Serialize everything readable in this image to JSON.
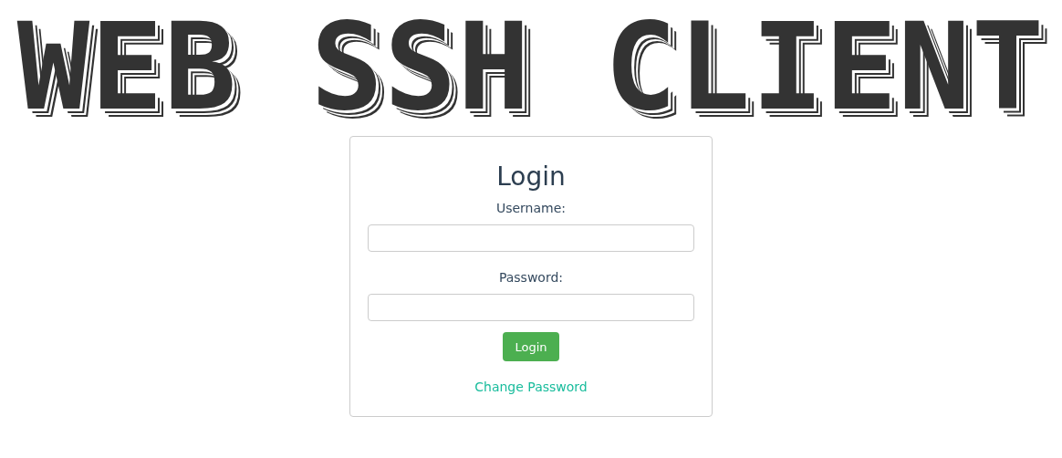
{
  "banner": {
    "title": "WEB SSH CLIENT"
  },
  "login_form": {
    "heading": "Login",
    "fields": [
      {
        "label": "Username:"
      },
      {
        "label": "Password:"
      }
    ],
    "submit_button": "Login",
    "link": "Change Password"
  }
}
